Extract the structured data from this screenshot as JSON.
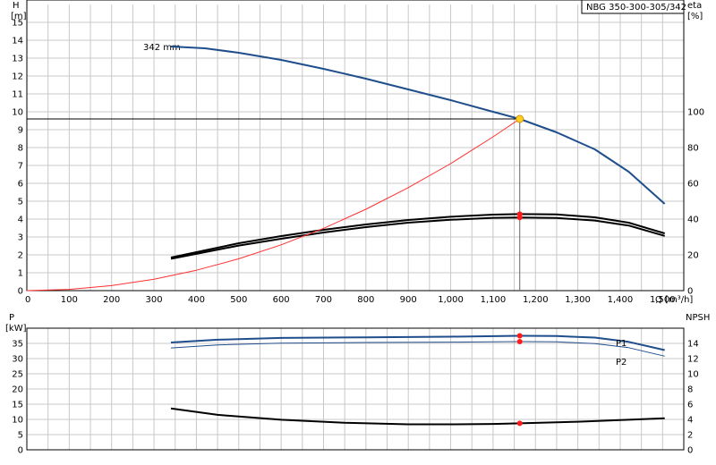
{
  "chart_data": [
    {
      "id": "top",
      "type": "line",
      "model_label": "NBG 350-300-305/342",
      "impeller_label": "342 mm",
      "x_axis": {
        "label": "Q [m³/h]",
        "range": [
          0,
          1550
        ],
        "ticks": [
          0,
          100,
          200,
          300,
          400,
          500,
          600,
          700,
          800,
          900,
          1000,
          1100,
          1200,
          1300,
          1400,
          1500
        ],
        "tick_labels": [
          "0",
          "100",
          "200",
          "300",
          "400",
          "500",
          "600",
          "700",
          "800",
          "900",
          "1,000",
          "1,100",
          "1,200",
          "1,300",
          "1,400",
          "1,500"
        ]
      },
      "y_left": {
        "label_1": "H",
        "label_2": "[m]",
        "range": [
          0,
          16
        ],
        "ticks": [
          0,
          1,
          2,
          3,
          4,
          5,
          6,
          7,
          8,
          9,
          10,
          11,
          12,
          13,
          14,
          15
        ]
      },
      "y_right": {
        "label_1": "eta",
        "label_2": "[%]",
        "range": [
          0,
          160
        ],
        "ticks": [
          0,
          20,
          40,
          60,
          80,
          100
        ]
      },
      "grid": true,
      "series": [
        {
          "key": "head",
          "color": "#1f4e8c",
          "axis": "left",
          "width": 2,
          "points": [
            [
              340,
              13.65
            ],
            [
              420,
              13.55
            ],
            [
              500,
              13.3
            ],
            [
              600,
              12.9
            ],
            [
              700,
              12.4
            ],
            [
              800,
              11.85
            ],
            [
              900,
              11.25
            ],
            [
              1000,
              10.65
            ],
            [
              1100,
              10.0
            ],
            [
              1163,
              9.6
            ],
            [
              1250,
              8.85
            ],
            [
              1340,
              7.9
            ],
            [
              1420,
              6.65
            ],
            [
              1505,
              4.85
            ]
          ]
        },
        {
          "key": "eta_1",
          "color": "#000000",
          "axis": "right",
          "width": 2,
          "points": [
            [
              340,
              18.5
            ],
            [
              420,
              22.5
            ],
            [
              500,
              26.5
            ],
            [
              600,
              30.5
            ],
            [
              700,
              34.0
            ],
            [
              800,
              37.0
            ],
            [
              900,
              39.5
            ],
            [
              1000,
              41.3
            ],
            [
              1100,
              42.5
            ],
            [
              1163,
              42.8
            ],
            [
              1250,
              42.6
            ],
            [
              1340,
              41.0
            ],
            [
              1420,
              38.0
            ],
            [
              1505,
              32.0
            ]
          ]
        },
        {
          "key": "eta_2",
          "color": "#000000",
          "axis": "right",
          "width": 2,
          "points": [
            [
              340,
              17.8
            ],
            [
              420,
              21.5
            ],
            [
              500,
              25.2
            ],
            [
              600,
              29.0
            ],
            [
              700,
              32.5
            ],
            [
              800,
              35.5
            ],
            [
              900,
              38.0
            ],
            [
              1000,
              39.6
            ],
            [
              1100,
              40.7
            ],
            [
              1163,
              40.9
            ],
            [
              1250,
              40.6
            ],
            [
              1340,
              39.2
            ],
            [
              1420,
              36.4
            ],
            [
              1505,
              30.6
            ]
          ]
        },
        {
          "key": "system",
          "color": "#ff3030",
          "axis": "left",
          "width": 1,
          "points": [
            [
              0,
              0
            ],
            [
              100,
              0.07
            ],
            [
              200,
              0.28
            ],
            [
              300,
              0.64
            ],
            [
              400,
              1.14
            ],
            [
              500,
              1.78
            ],
            [
              600,
              2.56
            ],
            [
              700,
              3.48
            ],
            [
              800,
              4.55
            ],
            [
              900,
              5.76
            ],
            [
              1000,
              7.1
            ],
            [
              1100,
              8.6
            ],
            [
              1163,
              9.6
            ]
          ]
        }
      ],
      "operating_point": {
        "q": 1163,
        "h": 9.6,
        "eta_1": 42.8,
        "eta_2": 40.9
      }
    },
    {
      "id": "bottom",
      "type": "line",
      "x_axis": {
        "range": [
          0,
          1550
        ],
        "ticks": [
          0,
          100,
          200,
          300,
          400,
          500,
          600,
          700,
          800,
          900,
          1000,
          1100,
          1200,
          1300,
          1400,
          1500
        ]
      },
      "y_left": {
        "label_1": "P",
        "label_2": "[kW]",
        "range": [
          0,
          40
        ],
        "ticks": [
          0,
          5,
          10,
          15,
          20,
          25,
          30,
          35
        ]
      },
      "y_right": {
        "label_1": "NPSH",
        "label_2": "",
        "range": [
          0,
          16
        ],
        "ticks": [
          0,
          2,
          4,
          6,
          8,
          10,
          12,
          14
        ]
      },
      "grid": true,
      "series": [
        {
          "key": "P1",
          "name": "P1",
          "color": "#1f4e8c",
          "axis": "left",
          "width": 2,
          "points": [
            [
              340,
              35.3
            ],
            [
              450,
              36.2
            ],
            [
              600,
              36.8
            ],
            [
              800,
              37.0
            ],
            [
              1000,
              37.2
            ],
            [
              1163,
              37.5
            ],
            [
              1250,
              37.4
            ],
            [
              1340,
              36.9
            ],
            [
              1420,
              35.5
            ],
            [
              1505,
              32.8
            ]
          ]
        },
        {
          "key": "P2",
          "name": "P2",
          "color": "#1f4e8c",
          "axis": "left",
          "width": 1,
          "points": [
            [
              340,
              33.5
            ],
            [
              450,
              34.5
            ],
            [
              600,
              35.1
            ],
            [
              800,
              35.3
            ],
            [
              1000,
              35.4
            ],
            [
              1163,
              35.6
            ],
            [
              1250,
              35.5
            ],
            [
              1340,
              34.9
            ],
            [
              1420,
              33.6
            ],
            [
              1505,
              30.8
            ]
          ]
        },
        {
          "key": "npsh",
          "color": "#000000",
          "axis": "right",
          "width": 2,
          "points": [
            [
              340,
              5.45
            ],
            [
              450,
              4.6
            ],
            [
              600,
              3.95
            ],
            [
              750,
              3.55
            ],
            [
              900,
              3.35
            ],
            [
              1000,
              3.35
            ],
            [
              1100,
              3.4
            ],
            [
              1163,
              3.48
            ],
            [
              1300,
              3.7
            ],
            [
              1420,
              3.95
            ],
            [
              1505,
              4.15
            ]
          ]
        }
      ],
      "operating_point": {
        "q": 1163,
        "p1": 37.5,
        "p2": 35.6,
        "npsh": 3.48
      }
    }
  ],
  "colors": {
    "head": "#1f4e8c",
    "system": "#ff3030",
    "marker": "#ff1a1a",
    "op_fill": "#ffd21f",
    "op_stroke": "#e08a00",
    "grid": "#c8c8c8"
  }
}
